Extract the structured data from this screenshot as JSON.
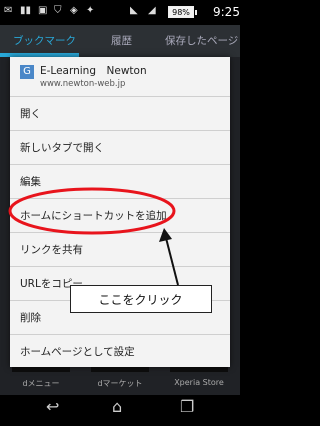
{
  "status_bar": {
    "battery": "98%",
    "time": "9:25"
  },
  "tabs": [
    {
      "label": "ブックマーク",
      "active": true
    },
    {
      "label": "履歴",
      "active": false
    },
    {
      "label": "保存したページ",
      "active": false
    }
  ],
  "background_items": [
    "dメニュー",
    "dマーケット",
    "Xperia Store"
  ],
  "dialog": {
    "title": "E-Learning　Newton",
    "url": "www.newton-web.jp",
    "menu": [
      "開く",
      "新しいタブで開く",
      "編集",
      "ホームにショートカットを追加",
      "リンクを共有",
      "URLをコピー",
      "削除",
      "ホームページとして設定"
    ]
  },
  "annotation": {
    "text": "ここをクリック",
    "highlight_color": "#e8141c"
  },
  "colors": {
    "accent": "#29a9d9",
    "dialog_bg": "#f3f3f3"
  }
}
